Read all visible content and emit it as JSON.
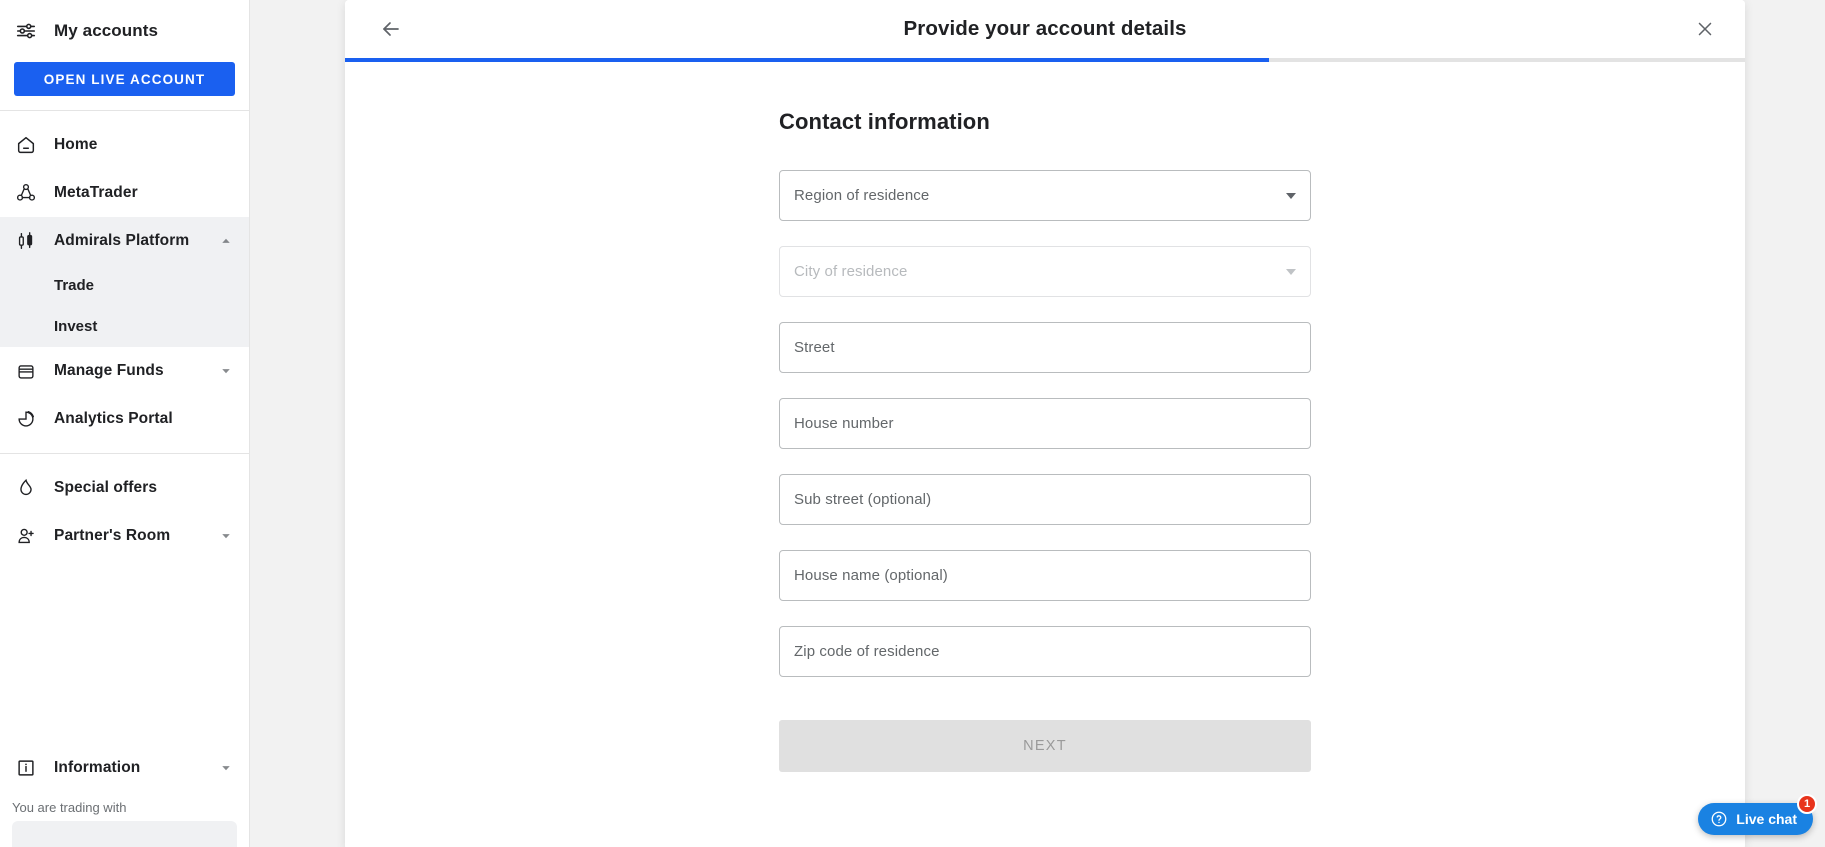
{
  "sidebar": {
    "accounts_label": "My accounts",
    "accounts_icon": "tune-sliders-icon",
    "cta_label": "OPEN LIVE ACCOUNT",
    "items": [
      {
        "label": "Home",
        "icon": "home-icon",
        "expandable": false
      },
      {
        "label": "MetaTrader",
        "icon": "metatrader-icon",
        "expandable": false
      },
      {
        "label": "Admirals Platform",
        "icon": "candlestick-icon",
        "expandable": true,
        "expanded": true
      },
      {
        "label": "Manage Funds",
        "icon": "wallet-icon",
        "expandable": true,
        "expanded": false
      },
      {
        "label": "Analytics Portal",
        "icon": "pie-chart-icon",
        "expandable": false
      },
      {
        "label": "Special offers",
        "icon": "flame-icon",
        "expandable": false
      },
      {
        "label": "Partner's Room",
        "icon": "person-add-icon",
        "expandable": true,
        "expanded": false
      },
      {
        "label": "Information",
        "icon": "info-box-icon",
        "expandable": true,
        "expanded": false
      }
    ],
    "submenu": [
      {
        "label": "Trade"
      },
      {
        "label": "Invest"
      }
    ],
    "trading_with_label": "You are trading with"
  },
  "modal": {
    "title": "Provide your account details",
    "back_icon": "arrow-left-icon",
    "close_icon": "close-icon",
    "progress_percent": 66,
    "section_title": "Contact information",
    "fields": [
      {
        "placeholder": "Region of residence",
        "type": "select",
        "disabled": false,
        "value": ""
      },
      {
        "placeholder": "City of residence",
        "type": "select",
        "disabled": true,
        "value": ""
      },
      {
        "placeholder": "Street",
        "type": "text",
        "disabled": false,
        "value": ""
      },
      {
        "placeholder": "House number",
        "type": "text",
        "disabled": false,
        "value": ""
      },
      {
        "placeholder": "Sub street (optional)",
        "type": "text",
        "disabled": false,
        "value": ""
      },
      {
        "placeholder": "House name (optional)",
        "type": "text",
        "disabled": false,
        "value": ""
      },
      {
        "placeholder": "Zip code of residence",
        "type": "text",
        "disabled": false,
        "value": ""
      }
    ],
    "next_label": "NEXT"
  },
  "livechat": {
    "label": "Live chat",
    "badge": "1",
    "icon": "question-circle-icon"
  },
  "colors": {
    "accent": "#1a60f0",
    "chat": "#1a82e2",
    "badge": "#e8341c",
    "text": "#202124",
    "placeholder": "#63676a"
  }
}
